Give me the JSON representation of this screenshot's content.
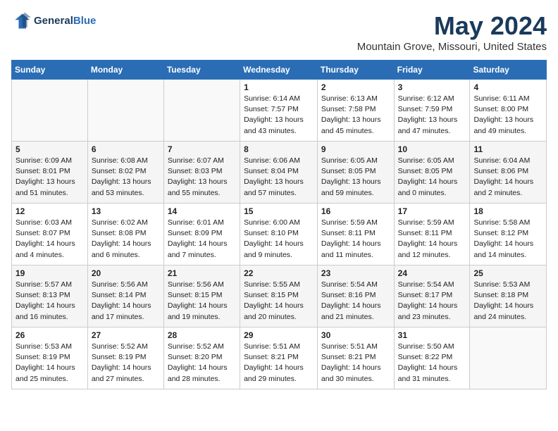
{
  "logo": {
    "line1": "General",
    "line2": "Blue"
  },
  "title": "May 2024",
  "subtitle": "Mountain Grove, Missouri, United States",
  "weekdays": [
    "Sunday",
    "Monday",
    "Tuesday",
    "Wednesday",
    "Thursday",
    "Friday",
    "Saturday"
  ],
  "weeks": [
    [
      {
        "day": "",
        "info": ""
      },
      {
        "day": "",
        "info": ""
      },
      {
        "day": "",
        "info": ""
      },
      {
        "day": "1",
        "info": "Sunrise: 6:14 AM\nSunset: 7:57 PM\nDaylight: 13 hours\nand 43 minutes."
      },
      {
        "day": "2",
        "info": "Sunrise: 6:13 AM\nSunset: 7:58 PM\nDaylight: 13 hours\nand 45 minutes."
      },
      {
        "day": "3",
        "info": "Sunrise: 6:12 AM\nSunset: 7:59 PM\nDaylight: 13 hours\nand 47 minutes."
      },
      {
        "day": "4",
        "info": "Sunrise: 6:11 AM\nSunset: 8:00 PM\nDaylight: 13 hours\nand 49 minutes."
      }
    ],
    [
      {
        "day": "5",
        "info": "Sunrise: 6:09 AM\nSunset: 8:01 PM\nDaylight: 13 hours\nand 51 minutes."
      },
      {
        "day": "6",
        "info": "Sunrise: 6:08 AM\nSunset: 8:02 PM\nDaylight: 13 hours\nand 53 minutes."
      },
      {
        "day": "7",
        "info": "Sunrise: 6:07 AM\nSunset: 8:03 PM\nDaylight: 13 hours\nand 55 minutes."
      },
      {
        "day": "8",
        "info": "Sunrise: 6:06 AM\nSunset: 8:04 PM\nDaylight: 13 hours\nand 57 minutes."
      },
      {
        "day": "9",
        "info": "Sunrise: 6:05 AM\nSunset: 8:05 PM\nDaylight: 13 hours\nand 59 minutes."
      },
      {
        "day": "10",
        "info": "Sunrise: 6:05 AM\nSunset: 8:05 PM\nDaylight: 14 hours\nand 0 minutes."
      },
      {
        "day": "11",
        "info": "Sunrise: 6:04 AM\nSunset: 8:06 PM\nDaylight: 14 hours\nand 2 minutes."
      }
    ],
    [
      {
        "day": "12",
        "info": "Sunrise: 6:03 AM\nSunset: 8:07 PM\nDaylight: 14 hours\nand 4 minutes."
      },
      {
        "day": "13",
        "info": "Sunrise: 6:02 AM\nSunset: 8:08 PM\nDaylight: 14 hours\nand 6 minutes."
      },
      {
        "day": "14",
        "info": "Sunrise: 6:01 AM\nSunset: 8:09 PM\nDaylight: 14 hours\nand 7 minutes."
      },
      {
        "day": "15",
        "info": "Sunrise: 6:00 AM\nSunset: 8:10 PM\nDaylight: 14 hours\nand 9 minutes."
      },
      {
        "day": "16",
        "info": "Sunrise: 5:59 AM\nSunset: 8:11 PM\nDaylight: 14 hours\nand 11 minutes."
      },
      {
        "day": "17",
        "info": "Sunrise: 5:59 AM\nSunset: 8:11 PM\nDaylight: 14 hours\nand 12 minutes."
      },
      {
        "day": "18",
        "info": "Sunrise: 5:58 AM\nSunset: 8:12 PM\nDaylight: 14 hours\nand 14 minutes."
      }
    ],
    [
      {
        "day": "19",
        "info": "Sunrise: 5:57 AM\nSunset: 8:13 PM\nDaylight: 14 hours\nand 16 minutes."
      },
      {
        "day": "20",
        "info": "Sunrise: 5:56 AM\nSunset: 8:14 PM\nDaylight: 14 hours\nand 17 minutes."
      },
      {
        "day": "21",
        "info": "Sunrise: 5:56 AM\nSunset: 8:15 PM\nDaylight: 14 hours\nand 19 minutes."
      },
      {
        "day": "22",
        "info": "Sunrise: 5:55 AM\nSunset: 8:15 PM\nDaylight: 14 hours\nand 20 minutes."
      },
      {
        "day": "23",
        "info": "Sunrise: 5:54 AM\nSunset: 8:16 PM\nDaylight: 14 hours\nand 21 minutes."
      },
      {
        "day": "24",
        "info": "Sunrise: 5:54 AM\nSunset: 8:17 PM\nDaylight: 14 hours\nand 23 minutes."
      },
      {
        "day": "25",
        "info": "Sunrise: 5:53 AM\nSunset: 8:18 PM\nDaylight: 14 hours\nand 24 minutes."
      }
    ],
    [
      {
        "day": "26",
        "info": "Sunrise: 5:53 AM\nSunset: 8:19 PM\nDaylight: 14 hours\nand 25 minutes."
      },
      {
        "day": "27",
        "info": "Sunrise: 5:52 AM\nSunset: 8:19 PM\nDaylight: 14 hours\nand 27 minutes."
      },
      {
        "day": "28",
        "info": "Sunrise: 5:52 AM\nSunset: 8:20 PM\nDaylight: 14 hours\nand 28 minutes."
      },
      {
        "day": "29",
        "info": "Sunrise: 5:51 AM\nSunset: 8:21 PM\nDaylight: 14 hours\nand 29 minutes."
      },
      {
        "day": "30",
        "info": "Sunrise: 5:51 AM\nSunset: 8:21 PM\nDaylight: 14 hours\nand 30 minutes."
      },
      {
        "day": "31",
        "info": "Sunrise: 5:50 AM\nSunset: 8:22 PM\nDaylight: 14 hours\nand 31 minutes."
      },
      {
        "day": "",
        "info": ""
      }
    ]
  ]
}
